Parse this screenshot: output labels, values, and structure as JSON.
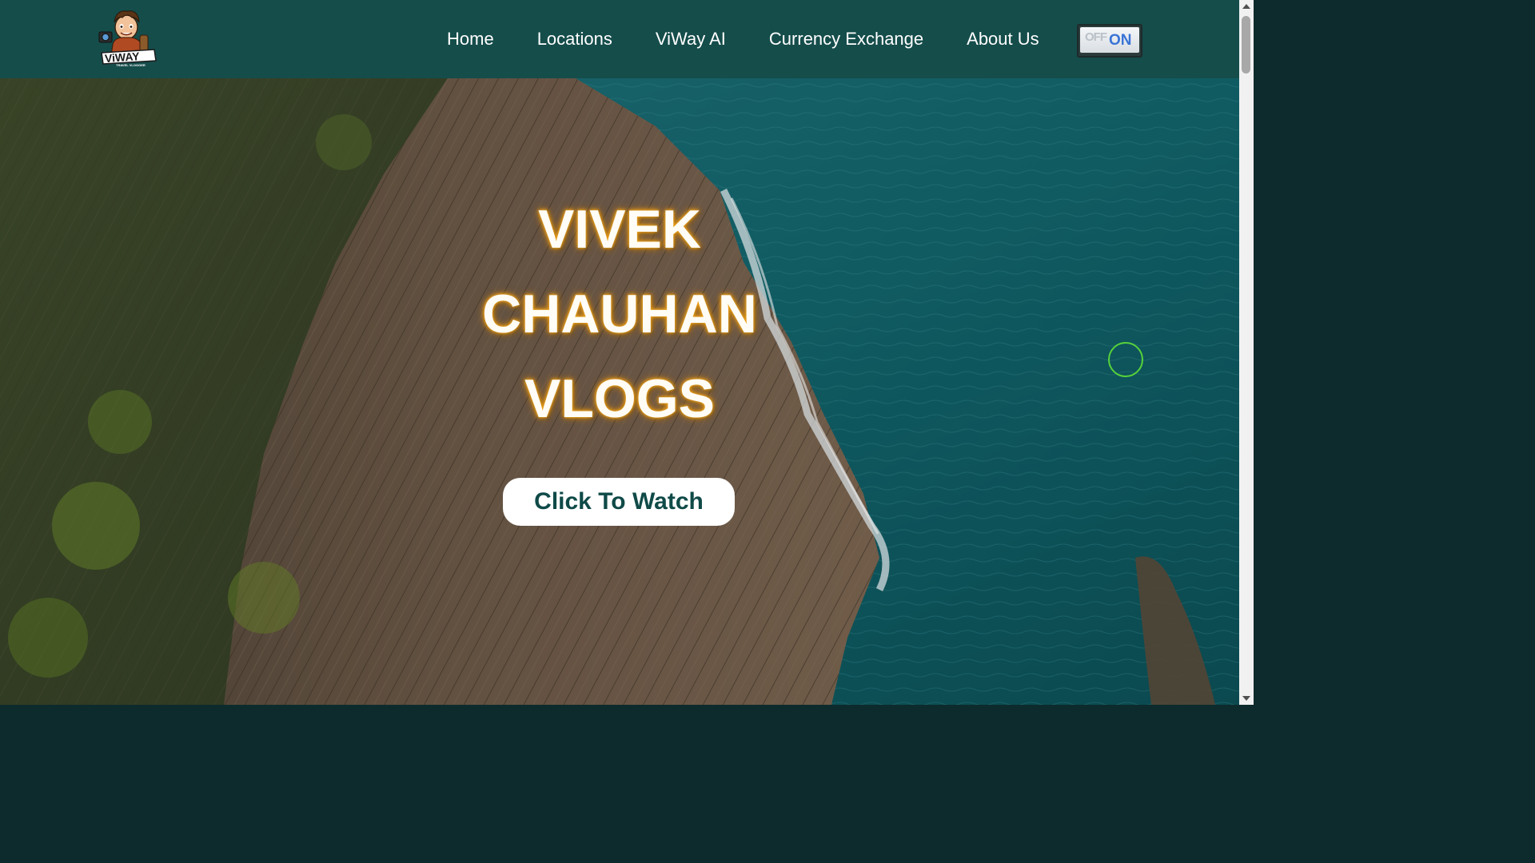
{
  "header": {
    "logo": {
      "icon": "viway-travel-vlogger-logo",
      "text": "ViWAY",
      "subtext": "TRAVEL VLOGGER"
    },
    "nav": [
      {
        "label": "Home"
      },
      {
        "label": "Locations"
      },
      {
        "label": "ViWay AI"
      },
      {
        "label": "Currency Exchange"
      },
      {
        "label": "About Us"
      }
    ],
    "toggle": {
      "off_label": "OFF",
      "on_label": "ON",
      "state": "on"
    }
  },
  "hero": {
    "title_lines": [
      "VIVEK",
      "CHAUHAN",
      "VLOGS"
    ],
    "cta_label": "Click To Watch",
    "background": "aerial-coastal-cliff-photo"
  },
  "colors": {
    "navbar_bg": "#154d4b",
    "cta_text": "#0f4a48",
    "title_glow": "#f0a51c",
    "toggle_on": "#3a74d6"
  }
}
